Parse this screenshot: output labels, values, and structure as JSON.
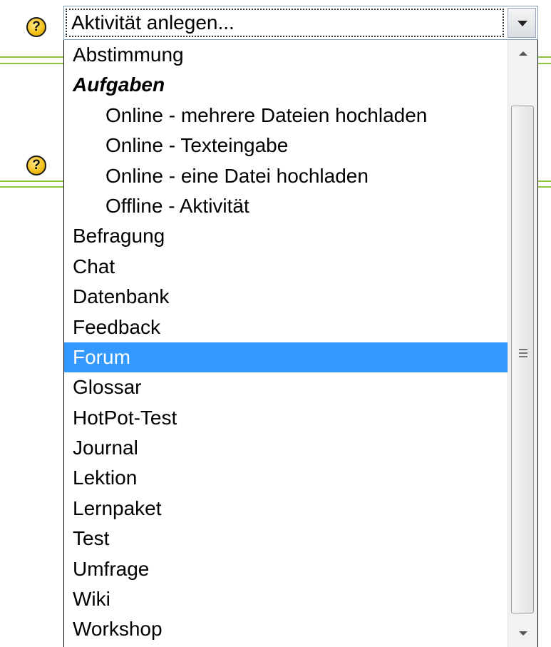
{
  "select": {
    "value": "Aktivität anlegen...",
    "help_glyph": "?"
  },
  "help_glyph_2": "?",
  "dropdown": {
    "selected": "Forum",
    "options": [
      {
        "label": "Abstimmung",
        "type": "option"
      },
      {
        "label": "Aufgaben",
        "type": "group"
      },
      {
        "label": "Online - mehrere Dateien hochladen",
        "type": "sub"
      },
      {
        "label": "Online - Texteingabe",
        "type": "sub"
      },
      {
        "label": "Online - eine Datei hochladen",
        "type": "sub"
      },
      {
        "label": "Offline - Aktivität",
        "type": "sub"
      },
      {
        "label": "Befragung",
        "type": "option"
      },
      {
        "label": "Chat",
        "type": "option"
      },
      {
        "label": "Datenbank",
        "type": "option"
      },
      {
        "label": "Feedback",
        "type": "option"
      },
      {
        "label": "Forum",
        "type": "option"
      },
      {
        "label": "Glossar",
        "type": "option"
      },
      {
        "label": "HotPot-Test",
        "type": "option"
      },
      {
        "label": "Journal",
        "type": "option"
      },
      {
        "label": "Lektion",
        "type": "option"
      },
      {
        "label": "Lernpaket",
        "type": "option"
      },
      {
        "label": "Test",
        "type": "option"
      },
      {
        "label": "Umfrage",
        "type": "option"
      },
      {
        "label": "Wiki",
        "type": "option"
      },
      {
        "label": "Workshop",
        "type": "option"
      }
    ]
  },
  "colors": {
    "selection": "#3399ff",
    "divider": "#8cc63f",
    "help_icon": "#f6c21c"
  },
  "icons": {
    "help": "help-icon",
    "dropdown_arrow": "chevron-down-icon",
    "scroll_up": "scroll-up-arrow-icon",
    "scroll_down": "scroll-down-arrow-icon"
  }
}
